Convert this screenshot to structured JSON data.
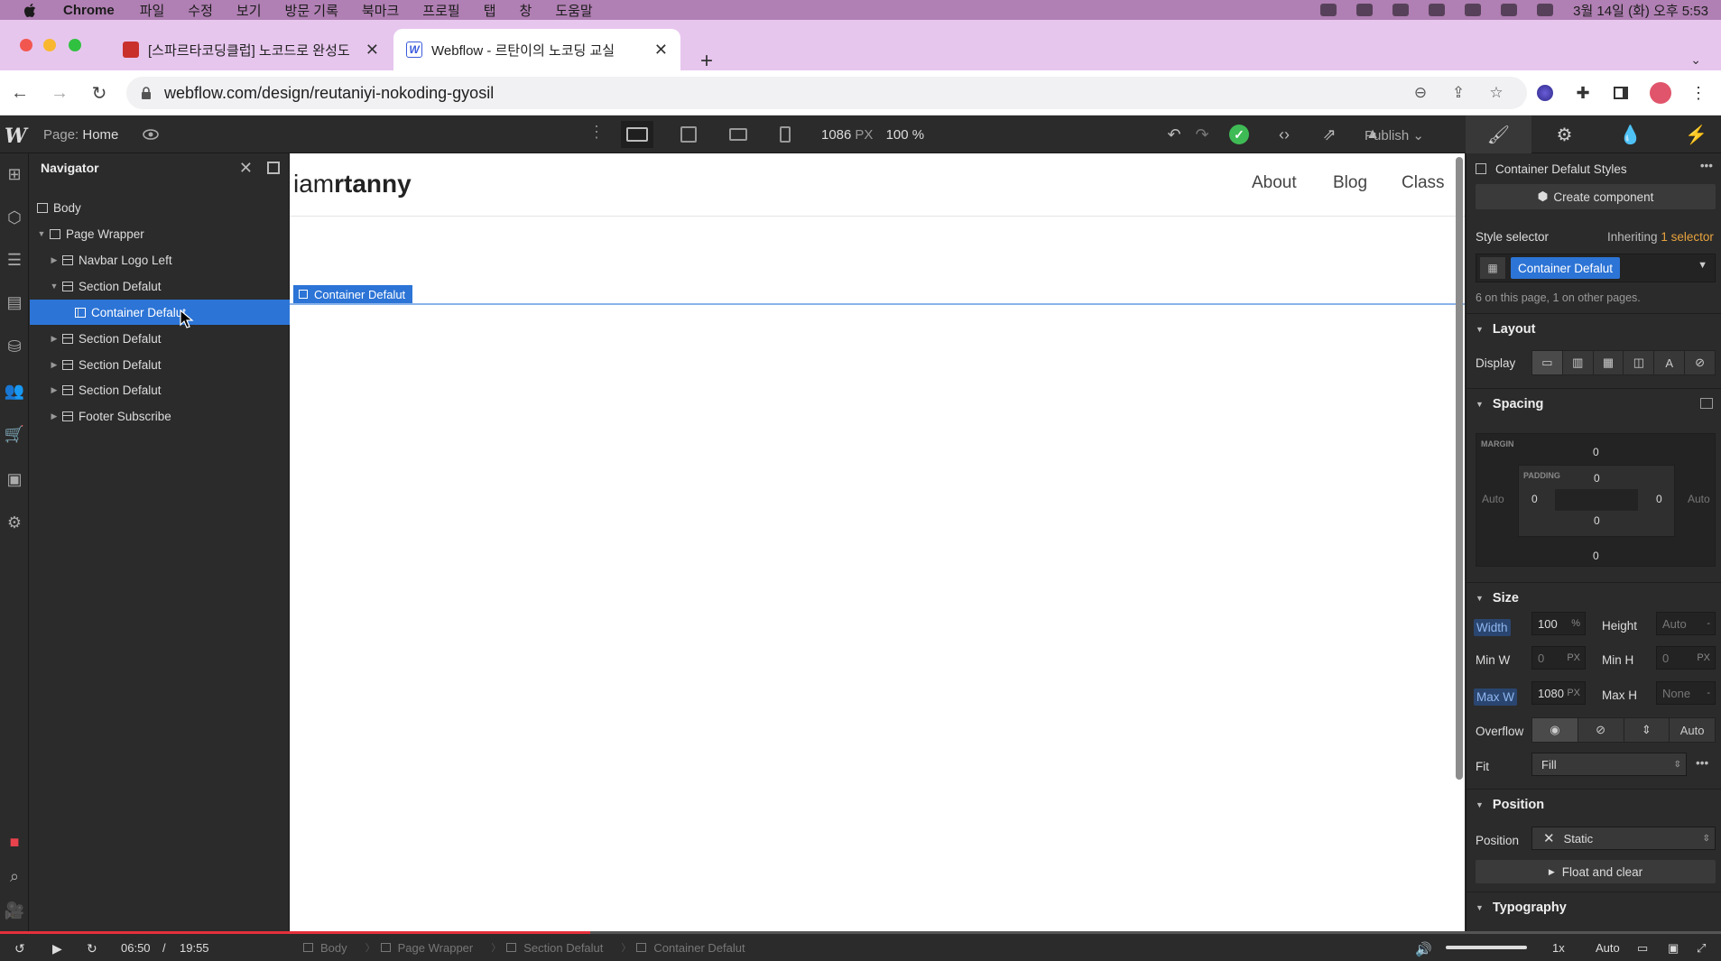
{
  "menubar": {
    "app": "Chrome",
    "items": [
      "파일",
      "수정",
      "보기",
      "방문 기록",
      "북마크",
      "프로필",
      "탭",
      "창",
      "도움말"
    ],
    "clock": "3월 14일 (화) 오후 5:53"
  },
  "tabs": [
    {
      "title": "[스파르타코딩클럽] 노코드로 완성도",
      "icon_color": "#c9302c"
    },
    {
      "title": "Webflow - 르탄이의 노코딩 교실",
      "icon_letter": "W",
      "icon_color": "#3b5bdb"
    }
  ],
  "address": {
    "url": "webflow.com/design/reutaniyi-nokoding-gyosil"
  },
  "webflow": {
    "page_label": "Page:",
    "page_name": "Home",
    "width_value": "1086",
    "width_unit": "PX",
    "zoom": "100 %",
    "publish": "Publish"
  },
  "navigator": {
    "title": "Navigator",
    "items": [
      {
        "label": "Body"
      },
      {
        "label": "Page Wrapper"
      },
      {
        "label": "Navbar Logo Left"
      },
      {
        "label": "Section Defalut"
      },
      {
        "label": "Container Defalut"
      },
      {
        "label": "Section Defalut"
      },
      {
        "label": "Section Defalut"
      },
      {
        "label": "Section Defalut"
      },
      {
        "label": "Footer Subscribe"
      }
    ]
  },
  "canvas": {
    "brand_light": "iam",
    "brand_bold": "rtanny",
    "links": [
      "About",
      "Blog",
      "Class"
    ],
    "selected_tag": "Container Defalut"
  },
  "panel": {
    "title": "Container Defalut Styles",
    "create_component": "Create component",
    "style_selector": "Style selector",
    "inheriting": "Inheriting",
    "inheriting_count": "1 selector",
    "selector_chip": "Container Defalut",
    "usage": "6 on this page, 1 on other pages.",
    "layout": "Layout",
    "display": "Display",
    "spacing": "Spacing",
    "margin_label": "MARGIN",
    "padding_label": "PADDING",
    "margin": {
      "top": "0",
      "bottom": "0",
      "left": "Auto",
      "right": "Auto"
    },
    "padding": {
      "top": "0",
      "bottom": "0",
      "left": "0",
      "right": "0"
    },
    "size": "Size",
    "width_label": "Width",
    "width_value": "100",
    "width_unit": "%",
    "height_label": "Height",
    "height_value": "Auto",
    "height_unit": "-",
    "minw_label": "Min W",
    "minw_value": "0",
    "minw_unit": "PX",
    "minh_label": "Min H",
    "minh_value": "0",
    "minh_unit": "PX",
    "maxw_label": "Max W",
    "maxw_value": "1080",
    "maxw_unit": "PX",
    "maxh_label": "Max H",
    "maxh_value": "None",
    "maxh_unit": "-",
    "overflow_label": "Overflow",
    "overflow_auto": "Auto",
    "fit_label": "Fit",
    "fit_value": "Fill",
    "position_section": "Position",
    "position_label": "Position",
    "position_value": "Static",
    "float_clear": "Float and clear",
    "typography": "Typography"
  },
  "video": {
    "current": "06:50",
    "separator": "/",
    "total": "19:55",
    "progress": 0.343,
    "speed": "1x",
    "quality": "Auto"
  },
  "breadcrumbs": [
    "Body",
    "Page Wrapper",
    "Section Defalut",
    "Container Defalut"
  ]
}
